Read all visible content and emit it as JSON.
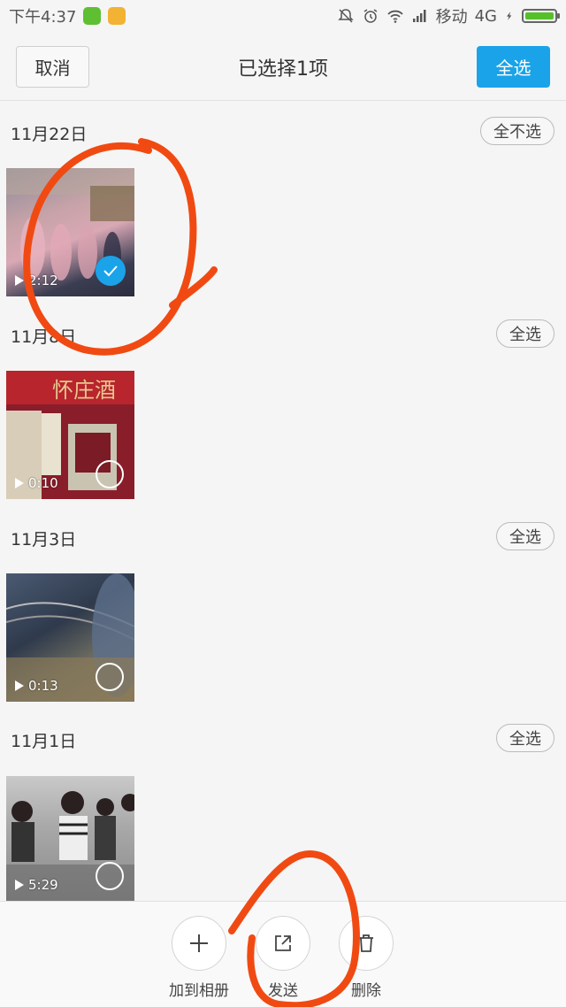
{
  "status_bar": {
    "time": "下午4:37",
    "carrier": "移动",
    "network": "4G",
    "battery_level": 1.0,
    "icons": [
      "battery-app-icon",
      "app-icon",
      "mute-icon",
      "alarm-icon",
      "wifi-icon",
      "signal-icon",
      "charging-icon",
      "battery-icon"
    ]
  },
  "header": {
    "cancel_label": "取消",
    "title": "已选择1项",
    "select_all_label": "全选"
  },
  "sections": [
    {
      "date": "11月22日",
      "action_label": "全不选",
      "video": {
        "duration": "2:12",
        "selected": true
      }
    },
    {
      "date": "11月8日",
      "action_label": "全选",
      "video": {
        "duration": "0:10",
        "selected": false
      }
    },
    {
      "date": "11月3日",
      "action_label": "全选",
      "video": {
        "duration": "0:13",
        "selected": false
      }
    },
    {
      "date": "11月1日",
      "action_label": "全选",
      "video": {
        "duration": "5:29",
        "selected": false
      }
    }
  ],
  "toolbar": {
    "add_to_album_label": "加到相册",
    "send_label": "发送",
    "delete_label": "删除"
  },
  "colors": {
    "accent": "#1aa3e8",
    "annotation": "#f04a12",
    "background": "#f5f5f5"
  }
}
